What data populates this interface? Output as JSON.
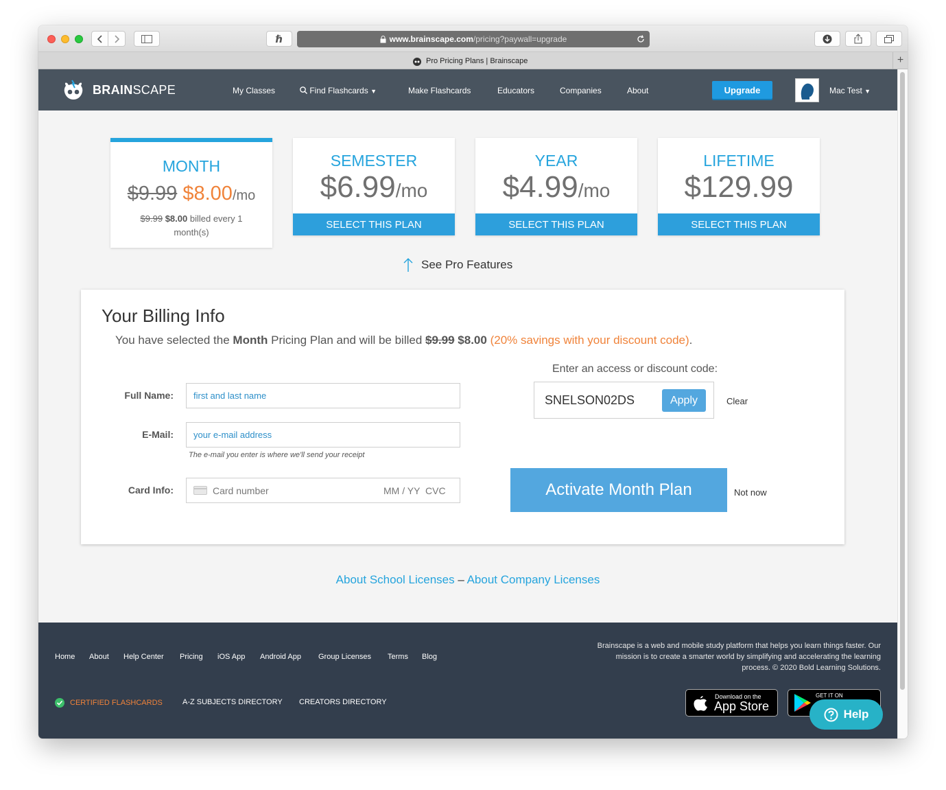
{
  "browser": {
    "url_domain": "www.brainscape.com",
    "url_path": "/pricing?paywall=upgrade",
    "tab_title": "Pro Pricing Plans | Brainscape",
    "hatch_icon": "ℏ"
  },
  "nav": {
    "brand_bold": "BRAIN",
    "brand_light": "SCAPE",
    "links": [
      "My Classes",
      "Find Flashcards",
      "Make Flashcards",
      "Educators",
      "Companies",
      "About"
    ],
    "upgrade": "Upgrade",
    "user": "Mac Test"
  },
  "plans": {
    "month": {
      "name": "MONTH",
      "old_price": "$9.99",
      "price": "$8.00",
      "unit": "/mo",
      "billed_old": "$9.99",
      "billed_new": "$8.00",
      "billed_text": " billed every 1",
      "billed_text2": "month(s)"
    },
    "semester": {
      "name": "SEMESTER",
      "price": "$6.99",
      "unit": "/mo",
      "button": "SELECT THIS PLAN"
    },
    "year": {
      "name": "YEAR",
      "price": "$4.99",
      "unit": "/mo",
      "button": "SELECT THIS PLAN"
    },
    "lifetime": {
      "name": "LIFETIME",
      "price": "$129.99",
      "button": "SELECT THIS PLAN"
    }
  },
  "see_pro": "See Pro Features",
  "billing": {
    "title": "Your Billing Info",
    "summary_1": "You have selected the ",
    "summary_plan": "Month",
    "summary_2": " Pricing Plan and will be billed ",
    "summary_old": "$9.99",
    "summary_new": "$8.00",
    "summary_savings": "(20% savings with your discount code)",
    "summary_period": ".",
    "full_name_label": "Full Name:",
    "full_name_placeholder": "first and last name",
    "email_label": "E-Mail:",
    "email_placeholder": "your e-mail address",
    "email_hint": "The e-mail you enter is where we'll send your receipt",
    "card_label": "Card Info:",
    "card_number": "Card number",
    "card_exp": "MM / YY",
    "card_cvc": "CVC",
    "code_label": "Enter an access or discount code:",
    "code_value": "SNELSON02DS",
    "apply": "Apply",
    "clear": "Clear",
    "activate": "Activate Month Plan",
    "not_now": "Not now"
  },
  "licenses": {
    "school": "About School Licenses",
    "dash": " – ",
    "company": "About Company Licenses"
  },
  "footer": {
    "links": [
      "Home",
      "About",
      "Help Center",
      "Pricing",
      "iOS App",
      "Android App",
      "Group Licenses",
      "Terms",
      "Blog"
    ],
    "about_1": "Brainscape is a web and mobile study platform that helps you learn things faster. Our",
    "about_2": "mission is to create a smarter world by simplifying and accelerating the learning",
    "about_3": "process. © 2020 Bold Learning Solutions.",
    "certified": "CERTIFIED FLASHCARDS",
    "az": "A-Z SUBJECTS DIRECTORY",
    "creators": "CREATORS DIRECTORY",
    "appstore_small": "Download on the",
    "appstore_big": "App Store",
    "googleplay_small": "GET IT ON",
    "help": "Help"
  },
  "colors": {
    "accent": "#25a4dd",
    "orange": "#f0833a",
    "nav_bg": "#49545f",
    "footer_bg": "#333e4d",
    "help_bg": "#27b2c7"
  }
}
